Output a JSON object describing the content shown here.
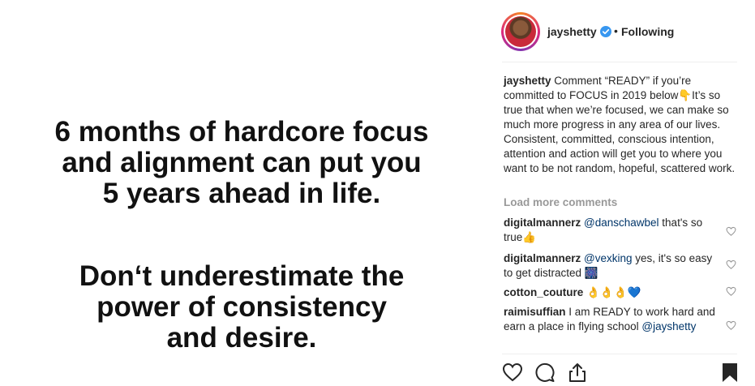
{
  "post": {
    "quote": {
      "block1": [
        "6 months of hardcore focus",
        "and alignment can put you",
        "5 years ahead in life."
      ],
      "block2": [
        "Don‘t underestimate the",
        "power of consistency",
        "and desire."
      ]
    }
  },
  "header": {
    "username": "jayshetty",
    "separator": "•",
    "follow_status": "Following",
    "verified_icon": "verified-badge-icon"
  },
  "caption": {
    "username": "jayshetty",
    "text": "Comment “READY” if you’re committed to FOCUS in 2019 below👇It’s so true that when we’re focused, we can make so much more progress in any area of our lives. Consistent, committed, conscious intention, attention and action will get you to where you want to be not random, hopeful, scattered work."
  },
  "load_more_label": "Load more comments",
  "comments": [
    {
      "username": "digitalmannerz",
      "mention": "@danschawbel",
      "text": " that's so true👍"
    },
    {
      "username": "digitalmannerz",
      "mention": "@vexking",
      "text": " yes, it's so easy to get distracted 🎆"
    },
    {
      "username": "cotton_couture",
      "mention": "",
      "text": " 👌👌👌💙"
    },
    {
      "username": "raimisuffian",
      "mention": "",
      "text": " I am READY to work hard and earn a place in flying school ",
      "mention_after": "@jayshetty"
    }
  ],
  "actions": [
    "heart-icon",
    "comment-icon",
    "share-icon",
    "bookmark-icon"
  ],
  "colors": {
    "accent_link": "#003569",
    "verified": "#3897f0",
    "muted": "#999999"
  }
}
